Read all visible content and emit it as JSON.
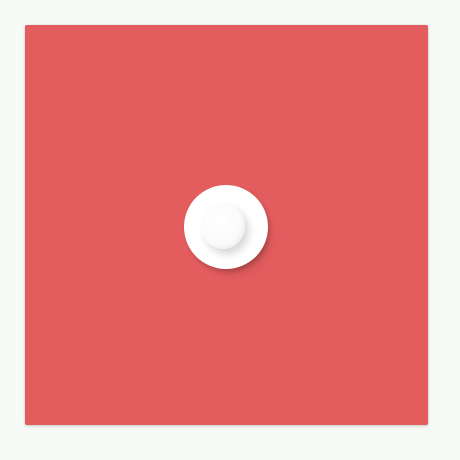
{
  "panel": {
    "background_color": "#e35d5f"
  },
  "knob": {
    "icon": "toggle-knob-icon",
    "color": "#ffffff"
  }
}
